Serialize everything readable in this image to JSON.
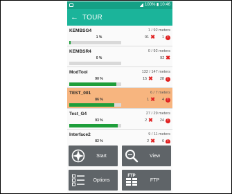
{
  "status_bar": {
    "text": "100% ▮ 10:46"
  },
  "app_bar": {
    "title": "TOUR"
  },
  "tours": [
    {
      "name": "KEMBSG4",
      "meters": "1 / 92 meters",
      "percent": "1 %",
      "progress": 0.01,
      "errors": "91",
      "alerts": "1",
      "highlight": false
    },
    {
      "name": "KEMBSR4",
      "meters": "0 / 92 meters",
      "percent": "0 %",
      "progress": 0.0,
      "errors": "92",
      "alerts": "",
      "highlight": false
    },
    {
      "name": "ModTool",
      "meters": "132 / 147 meters",
      "percent": "90 %",
      "progress": 0.9,
      "errors": "15",
      "alerts": "28",
      "highlight": false
    },
    {
      "name": "TEST_001",
      "meters": "6 / 7 meters",
      "percent": "86 %",
      "progress": 0.86,
      "errors": "1",
      "alerts": "4",
      "highlight": true
    },
    {
      "name": "Test_G4",
      "meters": "27 / 29 meters",
      "percent": "93 %",
      "progress": 0.93,
      "errors": "2",
      "alerts": "24",
      "highlight": false
    },
    {
      "name": "Interface2",
      "meters": "9 / 11 meters",
      "percent": "82 %",
      "progress": 0.82,
      "errors": "2",
      "alerts": "6",
      "highlight": false
    }
  ],
  "buttons": {
    "start": "Start",
    "view": "View",
    "options": "Options",
    "ftp": "FTP",
    "ftp_icon_text": "FTP"
  },
  "colors": {
    "appbar": "#1bb49a",
    "statusbar": "#15a085",
    "highlight_row": "#f7b57f",
    "progress": "#1e9e3a",
    "error": "#e02020",
    "button": "#5f6468"
  }
}
